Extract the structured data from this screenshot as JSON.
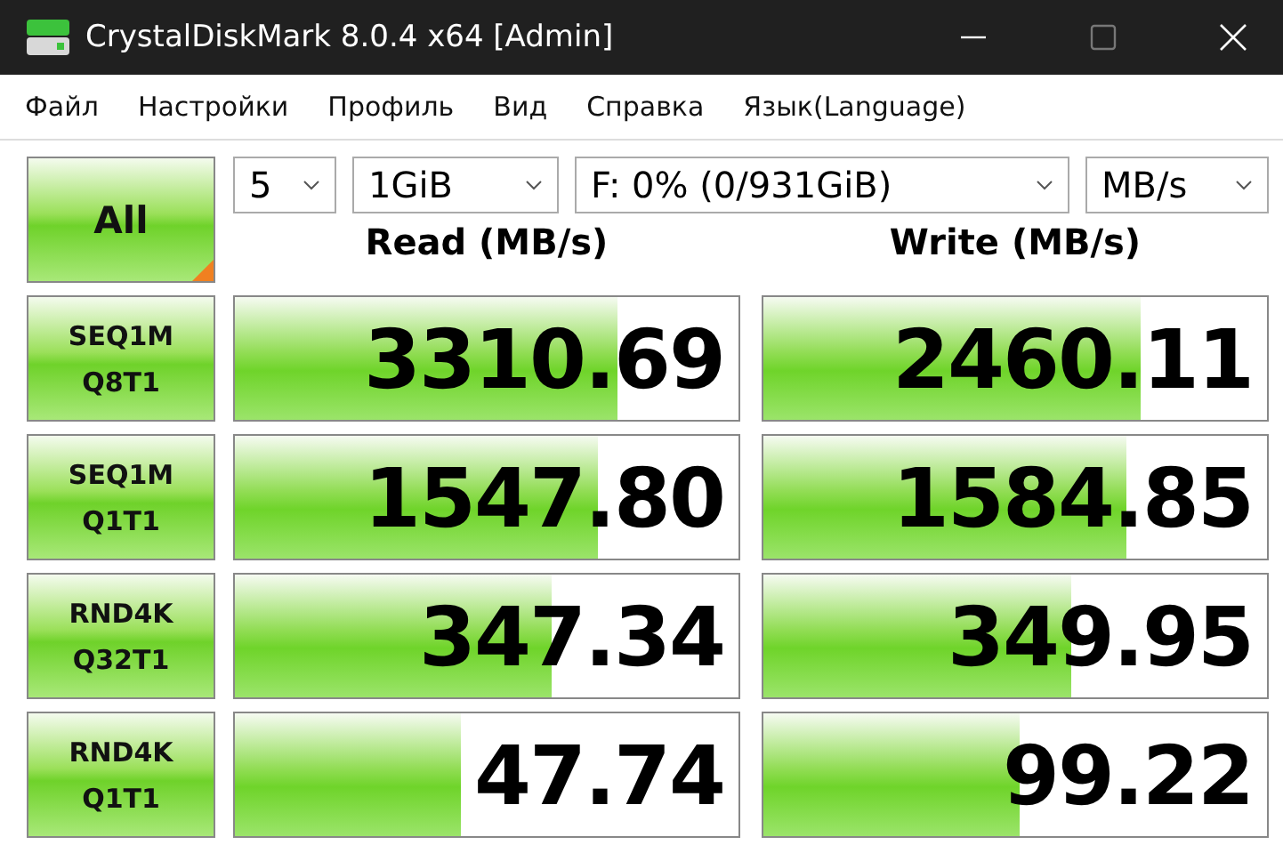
{
  "window": {
    "title": "CrystalDiskMark 8.0.4 x64 [Admin]"
  },
  "menu": [
    "Файл",
    "Настройки",
    "Профиль",
    "Вид",
    "Справка",
    "Язык(Language)"
  ],
  "all_button": {
    "label": "All"
  },
  "selectors": [
    {
      "kind": "count",
      "value": "5"
    },
    {
      "kind": "size",
      "value": "1GiB"
    },
    {
      "kind": "drive",
      "value": "F: 0% (0/931GiB)"
    },
    {
      "kind": "unit",
      "value": "MB/s"
    }
  ],
  "columns": [
    "Read (MB/s)",
    "Write (MB/s)"
  ],
  "rows": [
    {
      "line1": "SEQ1M",
      "line2": "Q8T1",
      "read": {
        "value": "3310.69",
        "level": 0.76
      },
      "write": {
        "value": "2460.11",
        "level": 0.75
      }
    },
    {
      "line1": "SEQ1M",
      "line2": "Q1T1",
      "read": {
        "value": "1547.80",
        "level": 0.72
      },
      "write": {
        "value": "1584.85",
        "level": 0.72
      }
    },
    {
      "line1": "RND4K",
      "line2": "Q32T1",
      "read": {
        "value": "347.34",
        "level": 0.63
      },
      "write": {
        "value": "349.95",
        "level": 0.61
      }
    },
    {
      "line1": "RND4K",
      "line2": "Q1T1",
      "read": {
        "value": "47.74",
        "level": 0.45
      },
      "write": {
        "value": "99.22",
        "level": 0.51
      }
    }
  ]
}
